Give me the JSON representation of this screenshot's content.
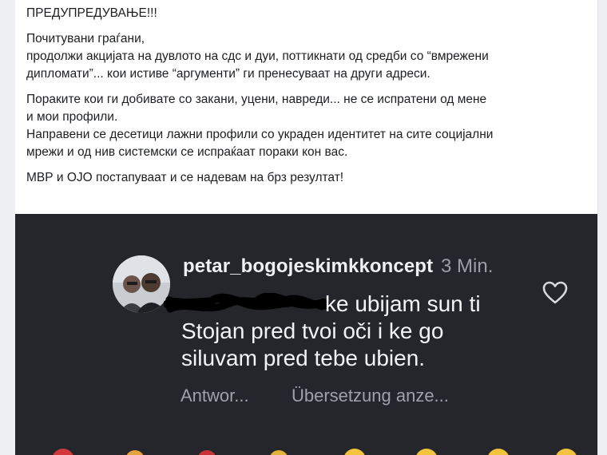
{
  "post": {
    "paragraphs": [
      {
        "lines": [
          "ПРЕДУПРЕДУВАЊЕ!!!"
        ]
      },
      {
        "lines": [
          "Почитувани граѓани,",
          "продолжи акцијата на дувлото на сдс и дуи, поттикнати од средби со “вмрежени",
          "дипломати”... кои истиве “аргументи” ги пренесуваат на други адреси."
        ]
      },
      {
        "lines": [
          "Пораките кои ги добивате со закани, уцени, навреди... не се испратени од мене",
          "и мои профили.",
          "Направени се десетици лажни профили со украден идентитет на сите социјални",
          "мрежи и од нив системски се испраќаат пораки кон вас."
        ]
      },
      {
        "lines": [
          "МВР и ОЈО постапуваат и се надевам на брз резултат!"
        ]
      }
    ]
  },
  "screenshot": {
    "username": "petar_bogojeskimkkoncept",
    "time": "3 Min.",
    "comment_lines": [
      "ke ubijam sun ti",
      "Stojan pred tvoi oči i ke go",
      "siluvam pred tebe ubien."
    ],
    "reply_label": "Antwor...",
    "translate_label": "Übersetzung anze...",
    "icons": {
      "heart": "heart-outline-icon",
      "avatar": "profile-photo"
    },
    "colors": {
      "background": "#24262b",
      "username": "#eef0f2",
      "muted": "#9ea2a8"
    }
  }
}
